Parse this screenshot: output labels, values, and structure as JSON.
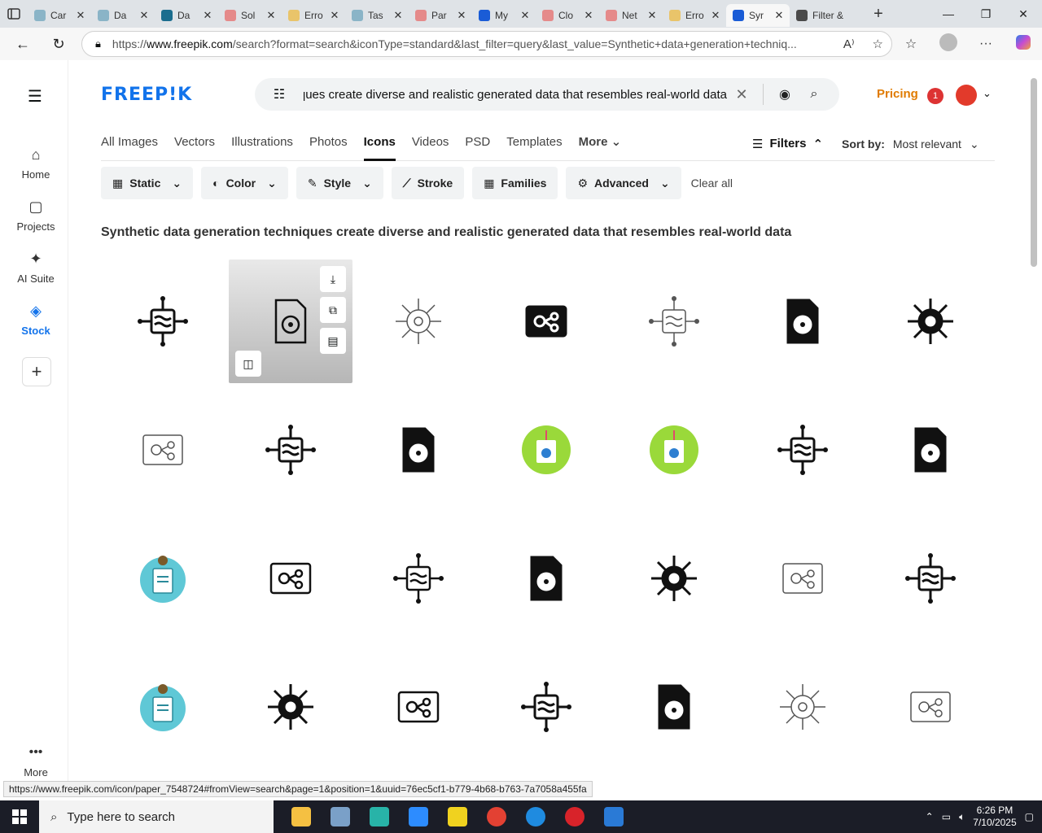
{
  "browser": {
    "tabs": [
      {
        "label": "Car",
        "color": "#8ab4c7"
      },
      {
        "label": "Da",
        "color": "#8ab4c7"
      },
      {
        "label": "Da",
        "color": "#1b6d8e"
      },
      {
        "label": "Sol",
        "color": "#e58a8a"
      },
      {
        "label": "Erro",
        "color": "#e9c46a"
      },
      {
        "label": "Tas",
        "color": "#8ab4c7"
      },
      {
        "label": "Par",
        "color": "#e58a8a"
      },
      {
        "label": "My",
        "color": "#1a5cd6"
      },
      {
        "label": "Clo",
        "color": "#e58a8a"
      },
      {
        "label": "Net",
        "color": "#e58a8a"
      },
      {
        "label": "Erro",
        "color": "#e9c46a"
      },
      {
        "label": "Syr",
        "color": "#1a5cd6"
      },
      {
        "label": "Filter &",
        "color": "#4a4a4a"
      }
    ],
    "url_host": "www.freepik.com",
    "url_prefix": "https://",
    "url_rest": "/search?format=search&iconType=standard&last_filter=query&last_value=Synthetic+data+generation+techniq..."
  },
  "site": {
    "logo": "FREEP!K",
    "search_query": "Synthetic data generation techniques create diverse and realistic generated data that resembles real-world data",
    "pricing": "Pricing",
    "notif_count": "1"
  },
  "leftnav": [
    {
      "label": "Home",
      "icon": "⌂",
      "name": "home"
    },
    {
      "label": "Projects",
      "icon": "▢",
      "name": "projects"
    },
    {
      "label": "AI Suite",
      "icon": "✦",
      "name": "ai-suite"
    },
    {
      "label": "Stock",
      "icon": "◈",
      "name": "stock"
    }
  ],
  "more_label": "More",
  "content_tabs": [
    "All Images",
    "Vectors",
    "Illustrations",
    "Photos",
    "Icons",
    "Videos",
    "PSD",
    "Templates",
    "More"
  ],
  "active_tab": "Icons",
  "filters_label": "Filters",
  "sort_label": "Sort by:",
  "sort_value": "Most relevant",
  "filter_buttons": [
    {
      "label": "Static",
      "icon": "▦",
      "dropdown": true
    },
    {
      "label": "Color",
      "icon": "◐",
      "dropdown": true
    },
    {
      "label": "Style",
      "icon": "✎",
      "dropdown": true
    },
    {
      "label": "Stroke",
      "icon": "⟋",
      "dropdown": false
    },
    {
      "label": "Families",
      "icon": "▦",
      "dropdown": false
    },
    {
      "label": "Advanced",
      "icon": "⚙",
      "dropdown": true
    }
  ],
  "clear_all": "Clear all",
  "heading": "Synthetic data generation techniques create diverse and realistic generated data that resembles real-world data",
  "status_url": "https://www.freepik.com/icon/paper_7548724#fromView=search&page=1&position=1&uuid=76ec5cf1-b779-4b68-b763-7a7058a455fa",
  "icons": [
    "solid",
    "outline",
    "thin",
    "solid",
    "thin",
    "solid",
    "solid",
    "thin",
    "solid",
    "solid",
    "green",
    "green",
    "solid",
    "solid",
    "teal",
    "outline",
    "outline",
    "solid",
    "solid",
    "thin",
    "solid",
    "teal",
    "solid",
    "outline",
    "solid",
    "solid",
    "thin",
    "thin"
  ],
  "taskbar": {
    "search_placeholder": "Type here to search",
    "time": "6:26 PM",
    "date": "7/10/2025",
    "apps": [
      "#f5c042",
      "#7aa0c8",
      "#28b3a8",
      "#2d8cff",
      "#f0d21f",
      "#e34133",
      "#1f8be0",
      "#d8232a",
      "#2a7ad6"
    ]
  }
}
